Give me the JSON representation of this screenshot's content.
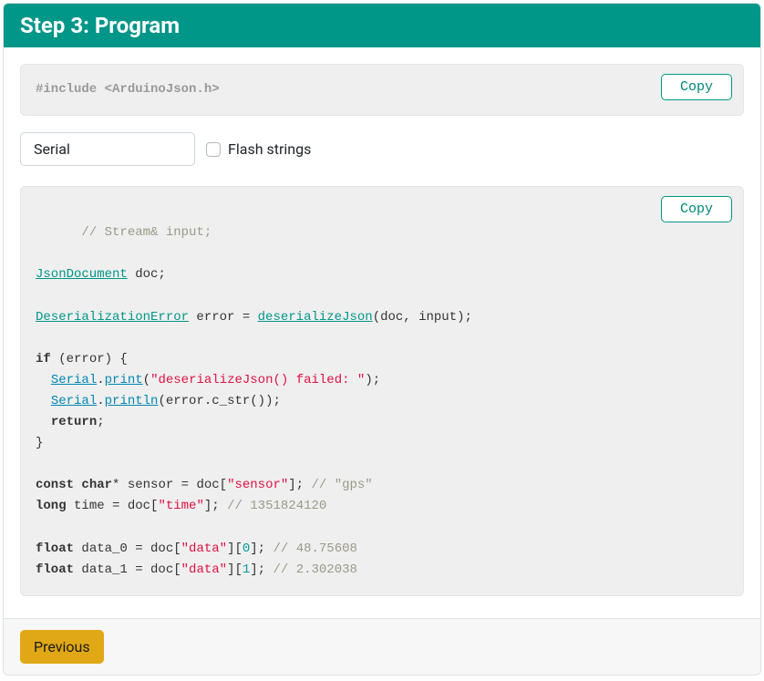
{
  "card": {
    "header_title": "Step 3: Program",
    "include_preproc": "#include",
    "include_file": " <ArduinoJson.h>",
    "copy_label_1": "Copy",
    "copy_label_2": "Copy",
    "select_value": "Serial",
    "checkbox_label": "Flash strings",
    "code": {
      "comment1": "// Stream& input;",
      "link_JsonDocument": "JsonDocument",
      "doc_decl": " doc;",
      "link_DeserializationError": "DeserializationError",
      "error_eq": " error = ",
      "link_deserializeJson": "deserializeJson",
      "deser_args": "(doc, input);",
      "kw_if": "if",
      "if_open": " (error) {",
      "link_Serial_1": "Serial",
      "dot1": ".",
      "link_print": "print",
      "print_open": "(",
      "str_fail": "\"deserializeJson() failed: \"",
      "print_close": ");",
      "link_Serial_2": "Serial",
      "dot2": ".",
      "link_println": "println",
      "println_args": "(error.c_str());",
      "kw_return": "return",
      "semicolon": ";",
      "close_brace": "}",
      "kw_const": "const",
      "sp1": " ",
      "kw_char": "char",
      "ptr_sensor_1": "* sensor = doc[",
      "str_sensor": "\"sensor\"",
      "ptr_sensor_2": "]; ",
      "cmt_gps": "// \"gps\"",
      "kw_long": "long",
      "time_1": " time = doc[",
      "str_time": "\"time\"",
      "time_2": "]; ",
      "cmt_time": "// 1351824120",
      "kw_float_1": "float",
      "d0_1": " data_0 = doc[",
      "str_data_0": "\"data\"",
      "d0_2": "][",
      "num0": "0",
      "d0_3": "]; ",
      "cmt_d0": "// 48.75608",
      "kw_float_2": "float",
      "d1_1": " data_1 = doc[",
      "str_data_1": "\"data\"",
      "d1_2": "][",
      "num1": "1",
      "d1_3": "]; ",
      "cmt_d1": "// 2.302038"
    },
    "footer_button": "Previous"
  }
}
